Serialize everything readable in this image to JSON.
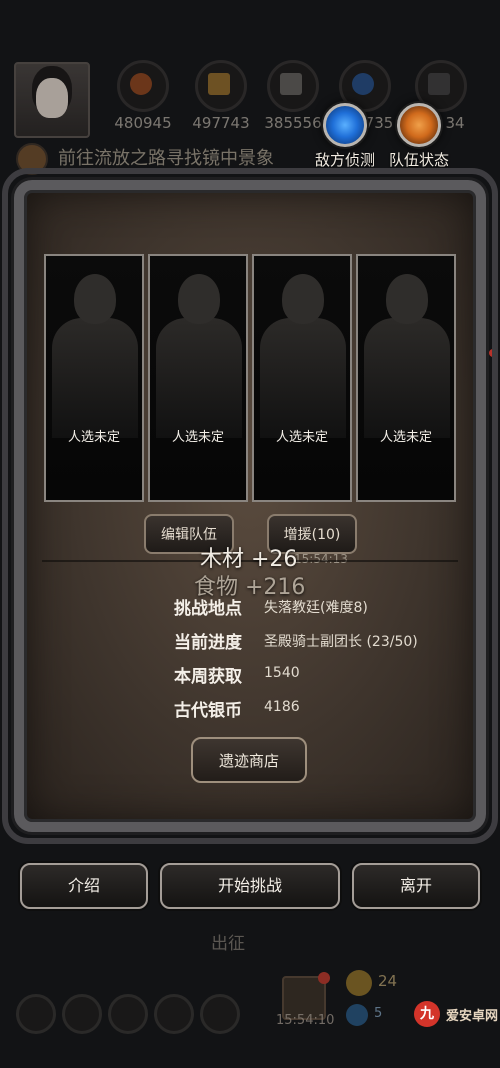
{
  "hud": {
    "resources": [
      {
        "icon": "orange-sphere-icon",
        "color": "#b5531f",
        "value": "480945"
      },
      {
        "icon": "wood-planks-icon",
        "color": "#b9852f",
        "value": "497743"
      },
      {
        "icon": "stone-icon",
        "color": "#7b7670",
        "value": "385556"
      },
      {
        "icon": "blue-gem-icon",
        "color": "#2a5fa8",
        "value": "735"
      },
      {
        "icon": "dark-crystal-icon",
        "color": "#4d4a4a",
        "value": "34"
      }
    ],
    "quest": "前往流放之路寻找镜中景象",
    "enemy_scout": "敌方侦测",
    "team_status": "队伍状态"
  },
  "party": {
    "slots": [
      {
        "status": "人选未定"
      },
      {
        "status": "人选未定"
      },
      {
        "status": "人选未定"
      },
      {
        "status": "人选未定"
      }
    ],
    "edit_team": "编辑队伍",
    "reinforce": "增援(10)",
    "timer": "15:54:13"
  },
  "floating_rewards": {
    "wood": "木材 +26",
    "food": "食物 +216"
  },
  "challenge": {
    "rows": [
      {
        "label": "挑战地点",
        "value": "失落教廷(难度8)"
      },
      {
        "label": "当前进度",
        "value": "圣殿骑士副团长 (23/50)"
      },
      {
        "label": "本周获取",
        "value": "1540"
      },
      {
        "label": "古代银币",
        "value": "4186"
      }
    ],
    "shop": "遗迹商店"
  },
  "actions": {
    "intro": "介绍",
    "start": "开始挑战",
    "leave": "离开"
  },
  "bottom": {
    "dispatch": "出征",
    "timer": "15:54:10",
    "coins": "24",
    "gems": "5"
  },
  "watermark": {
    "logo": "九",
    "text": "爱安卓网"
  },
  "colors": {
    "panel": "#4a3e33",
    "frame": "#5b5a5d",
    "enemy_scout_ring": "#1f6fd8",
    "team_status_ring": "#d06a1c"
  }
}
